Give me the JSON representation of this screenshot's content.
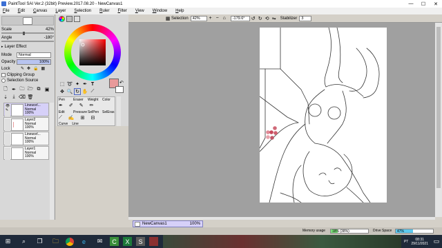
{
  "window": {
    "title": "PaintTool SAI Ver.2 (32bit) Preview.2017.08.20 - NewCanvas1",
    "minimize": "—",
    "maximize": "☐",
    "close": "✕"
  },
  "menu": [
    "File",
    "Edit",
    "Canvas",
    "Layer",
    "Selection",
    "Ruler",
    "Filter",
    "View",
    "Window",
    "Help"
  ],
  "toolbar": {
    "selection_label": "Selection",
    "zoom": "42%",
    "rotation": "-179.6°",
    "stabilizer_label": "Stabilizer",
    "stabilizer_value": "3"
  },
  "left": {
    "scale_label": "Scale",
    "scale_value": "42%",
    "angle_label": "Angle",
    "angle_value": "-180°",
    "layer_effect": "Layer Effect",
    "mode_label": "Mode",
    "mode_value": "Normal",
    "opacity_label": "Opacity",
    "opacity_value": "100%",
    "lock_label": "Lock",
    "clipping_label": "Clipping Group",
    "selection_source_label": "Selection Source",
    "layers": [
      {
        "name": "Lineworl...",
        "mode": "Normal",
        "opacity": "100%"
      },
      {
        "name": "Layer2",
        "mode": "Normal",
        "opacity": "100%"
      },
      {
        "name": "Lineworl...",
        "mode": "Normal",
        "opacity": "100%"
      },
      {
        "name": "Layer1",
        "mode": "Normal",
        "opacity": "100%"
      }
    ]
  },
  "tools": {
    "brush_names": [
      "Pen",
      "Eraser",
      "Weight",
      "Color"
    ],
    "brush_names2": [
      "Edit",
      "Pressure",
      "SelPen",
      "SelEras"
    ],
    "tabs": [
      "Curve",
      "Line"
    ]
  },
  "canvas_tab": {
    "name": "NewCanvas1",
    "zoom": "100%"
  },
  "status": {
    "memory_label": "Memory usage",
    "memory_value": "18% (38%)",
    "memory_fraction": 0.18,
    "drive_label": "Drive Space",
    "drive_value": "47%",
    "drive_fraction": 0.47
  },
  "taskbar": {
    "lang": "PT",
    "time": "08:31",
    "date": "29/11/2021"
  },
  "colors": {
    "main_swatch": "#e89a9a",
    "palette": [
      "#c84a5c",
      "#d66a78",
      "#e08a96",
      "#d06070",
      "#e8a0aa",
      "#c05868"
    ]
  }
}
